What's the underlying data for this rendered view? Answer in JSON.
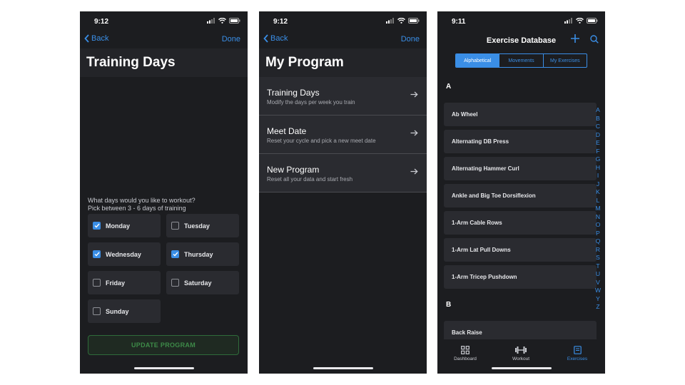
{
  "colors": {
    "accent": "#3a8ee6",
    "update_green": "#3d8a48",
    "background": "#1c1d20"
  },
  "screen1": {
    "time": "9:12",
    "back_label": "Back",
    "done_label": "Done",
    "title": "Training Days",
    "prompt_line1": "What days would you like to workout?",
    "prompt_line2": "Pick between 3 - 6 days of training",
    "days": [
      {
        "label": "Monday",
        "checked": true
      },
      {
        "label": "Tuesday",
        "checked": false
      },
      {
        "label": "Wednesday",
        "checked": true
      },
      {
        "label": "Thursday",
        "checked": true
      },
      {
        "label": "Friday",
        "checked": false
      },
      {
        "label": "Saturday",
        "checked": false
      },
      {
        "label": "Sunday",
        "checked": false
      }
    ],
    "update_button": "UPDATE PROGRAM"
  },
  "screen2": {
    "time": "9:12",
    "back_label": "Back",
    "done_label": "Done",
    "title": "My Program",
    "items": [
      {
        "title": "Training Days",
        "subtitle": "Modify the days per week you train",
        "icon": "arrow-right-icon"
      },
      {
        "title": "Meet Date",
        "subtitle": "Reset your cycle and pick a new meet date",
        "icon": "arrow-right-icon"
      },
      {
        "title": "New Program",
        "subtitle": "Reset all your data and start fresh",
        "icon": "arrow-right-icon"
      }
    ]
  },
  "screen3": {
    "time": "9:11",
    "title": "Exercise Database",
    "segments": [
      {
        "label": "Alphabetical",
        "active": true
      },
      {
        "label": "Movements",
        "active": false
      },
      {
        "label": "My Exercises",
        "active": false
      }
    ],
    "section_a": "A",
    "exercises_a": [
      "Ab Wheel",
      "Alternating DB Press",
      "Alternating Hammer Curl",
      "Ankle and Big Toe Dorsiflexion",
      "1-Arm Cable Rows",
      "1-Arm Lat Pull Downs",
      "1-Arm Tricep Pushdown"
    ],
    "section_b": "B",
    "exercises_b": [
      "Back Raise"
    ],
    "alphabet": [
      "A",
      "B",
      "C",
      "D",
      "E",
      "F",
      "G",
      "H",
      "I",
      "J",
      "K",
      "L",
      "M",
      "N",
      "O",
      "P",
      "Q",
      "R",
      "S",
      "T",
      "U",
      "V",
      "W",
      "Y",
      "Z"
    ],
    "tabs": [
      {
        "label": "Dashboard",
        "icon": "grid-icon",
        "active": false
      },
      {
        "label": "Workout",
        "icon": "dumbbell-icon",
        "active": false
      },
      {
        "label": "Exercises",
        "icon": "book-icon",
        "active": true
      }
    ]
  }
}
